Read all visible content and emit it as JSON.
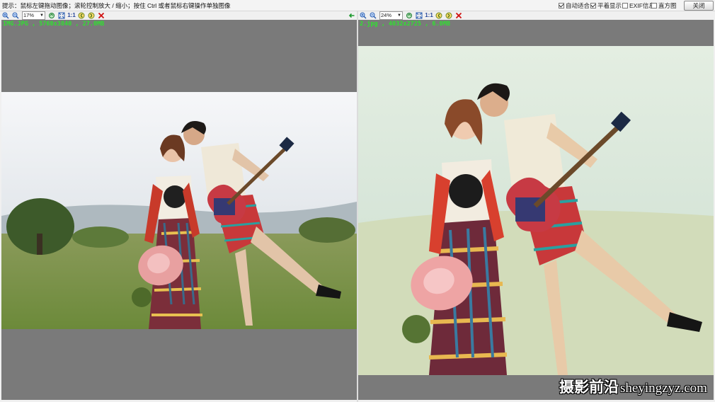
{
  "hint_text": "提示：鼠标左键拖动图像；滚轮控制放大 / 缩小；按住 Ctrl 或者鼠标右键操作单独图像",
  "options": [
    {
      "label": "自动适合",
      "checked": true
    },
    {
      "label": "平着显示",
      "checked": true
    },
    {
      "label": "EXIF信息",
      "checked": false
    },
    {
      "label": "直方图",
      "checked": false
    }
  ],
  "close_label": "关闭",
  "left": {
    "zoom": "17%",
    "info": "IMG.JPG , 5760x3840 , 27.0MB",
    "one_to_one": "1:1"
  },
  "right": {
    "zoom": "24%",
    "info": "2.jpg , 4032x2725 , 6.0MB",
    "one_to_one": "1:1"
  },
  "watermark": {
    "cn": "摄影前沿",
    "en": "sheyingzyz.com"
  },
  "colors": {
    "panel_bg": "#7a7a7a",
    "info_text": "#30e030",
    "close_x": "#d01010"
  },
  "icons": [
    "zoom-in-icon",
    "zoom-out-icon",
    "rotate-icon",
    "fit-icon",
    "rotate-left-icon",
    "rotate-right-icon",
    "close-x-icon",
    "back-arrow-icon"
  ]
}
